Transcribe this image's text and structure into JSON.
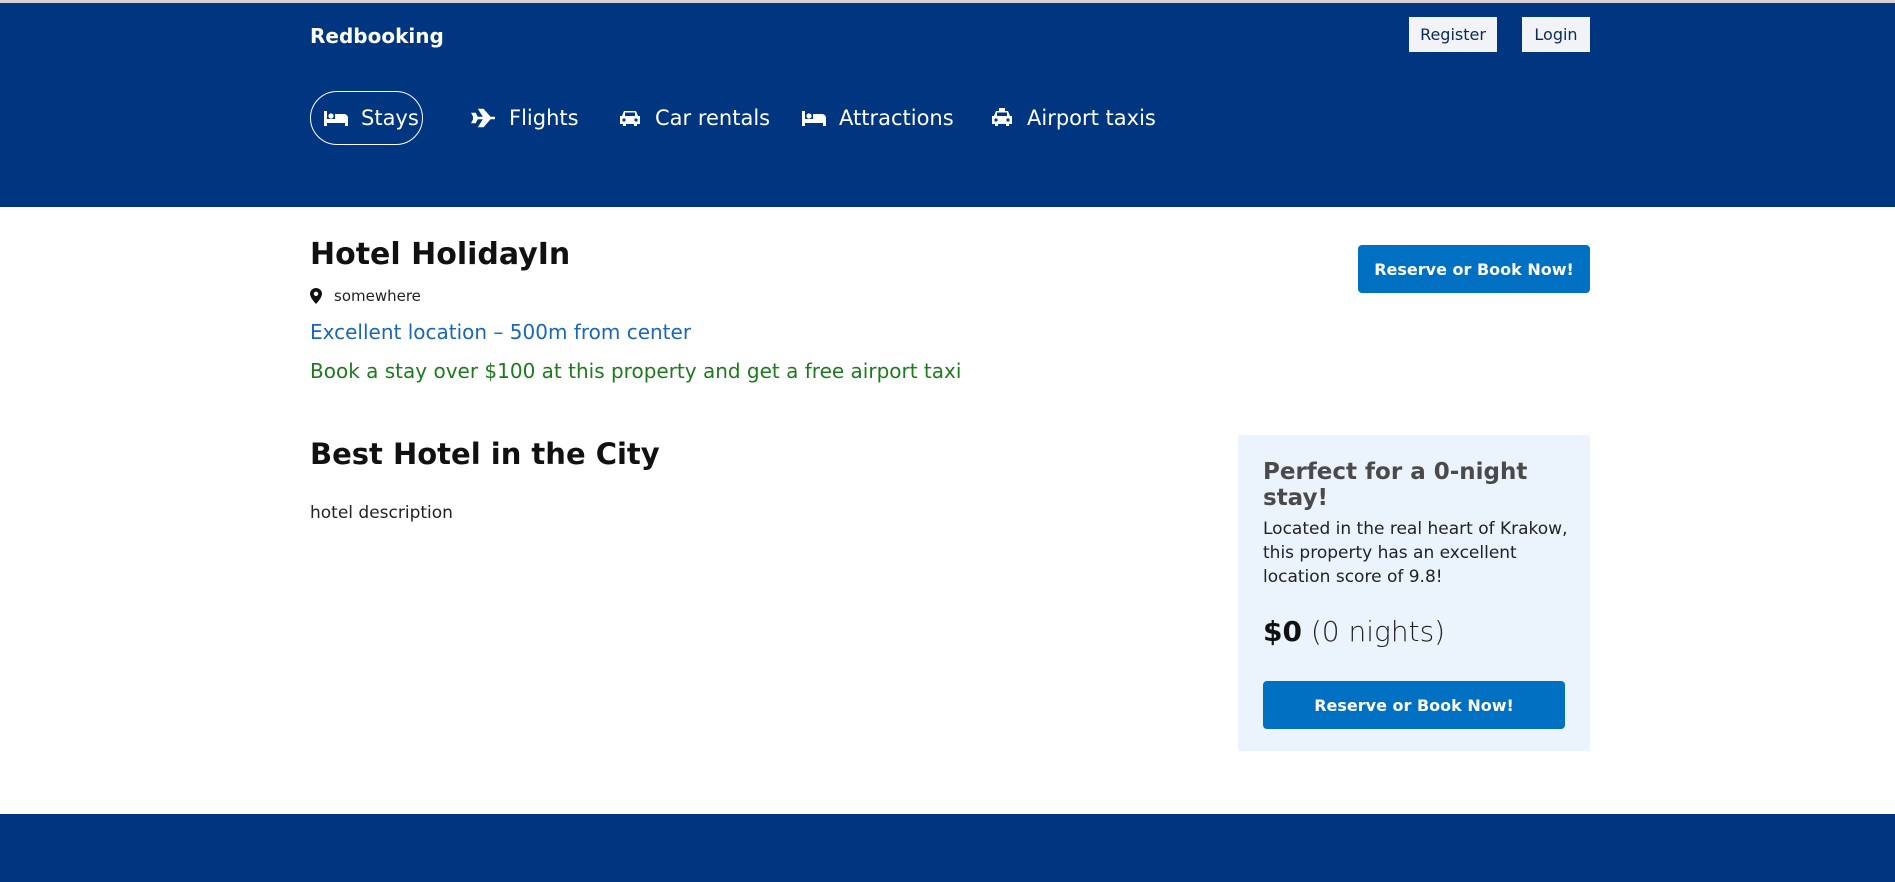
{
  "header": {
    "brand": "Redbooking",
    "register_label": "Register",
    "login_label": "Login",
    "nav": [
      {
        "label": "Stays",
        "icon": "bed-icon",
        "active": true
      },
      {
        "label": "Flights",
        "icon": "plane-icon",
        "active": false
      },
      {
        "label": "Car rentals",
        "icon": "car-icon",
        "active": false
      },
      {
        "label": "Attractions",
        "icon": "bed-icon",
        "active": false
      },
      {
        "label": "Airport taxis",
        "icon": "taxi-icon",
        "active": false
      }
    ]
  },
  "hotel": {
    "name": "Hotel HolidayIn",
    "address": "somewhere",
    "location_note": "Excellent location – 500m from center",
    "taxi_offer": "Book a stay over $100 at this property and get a free airport taxi",
    "reserve_label": "Reserve or Book Now!",
    "headline": "Best Hotel in the City",
    "description": "hotel description"
  },
  "side_card": {
    "title": "Perfect for a 0-night stay!",
    "text": "Located in the real heart of Krakow, this property has an excellent location score of 9.8!",
    "price": "$0",
    "nights": "(0 nights)",
    "reserve_label": "Reserve or Book Now!"
  },
  "colors": {
    "header_bg": "#003580",
    "primary_button": "#0071c2",
    "location_link": "#1a67b5",
    "offer_green": "#1f7a1f",
    "card_bg": "#ebf3fc"
  }
}
